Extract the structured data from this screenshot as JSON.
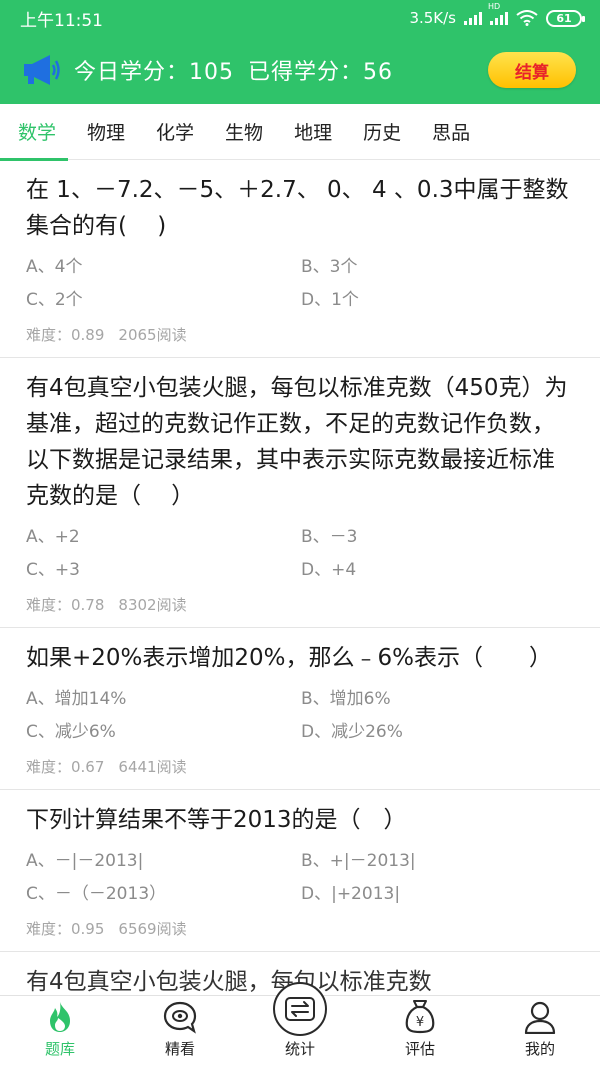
{
  "status": {
    "time": "上午11:51",
    "network_speed": "3.5K/s",
    "network_type": "HD",
    "battery": "61"
  },
  "header": {
    "today_credits_label": "今日学分：",
    "today_credits": "105",
    "earned_credits_label": "已得学分：",
    "earned_credits": "56",
    "settle_label": "结算"
  },
  "tabs": [
    {
      "label": "数学",
      "active": true
    },
    {
      "label": "物理"
    },
    {
      "label": "化学"
    },
    {
      "label": "生物"
    },
    {
      "label": "地理"
    },
    {
      "label": "历史"
    },
    {
      "label": "思品"
    }
  ],
  "questions": [
    {
      "title": "在 1、－7.2、－5、＋2.7、 0、 4 、0.3中属于整数集合的有(　 )",
      "options": [
        "A、4个",
        "B、3个",
        "C、2个",
        "D、1个"
      ],
      "difficulty_label": "难度：0.89",
      "reads": "2065阅读"
    },
    {
      "title": "有4包真空小包装火腿，每包以标准克数（450克）为基准，超过的克数记作正数，不足的克数记作负数，以下数据是记录结果，其中表示实际克数最接近标准克数的是（　 ）",
      "options": [
        "A、+2",
        "B、－3",
        "C、+3",
        "D、+4"
      ],
      "difficulty_label": "难度：0.78",
      "reads": "8302阅读"
    },
    {
      "title": "如果+20%表示增加20%，那么﹣6%表示（　　）",
      "options": [
        "A、增加14%",
        "B、增加6%",
        "C、减少6%",
        "D、减少26%"
      ],
      "difficulty_label": "难度：0.67",
      "reads": "6441阅读"
    },
    {
      "title": "下列计算结果不等于2013的是（　）",
      "options": [
        "A、－|－2013|",
        "B、+|－2013|",
        "C、－（－2013）",
        "D、|+2013|"
      ],
      "difficulty_label": "难度：0.95",
      "reads": "6569阅读"
    },
    {
      "title": "有4包真空小包装火腿，每包以标准克数"
    }
  ],
  "nav": [
    {
      "label": "题库",
      "icon": "flame-icon",
      "active": true
    },
    {
      "label": "精看",
      "icon": "eye-bubble-icon"
    },
    {
      "label": "统计",
      "icon": "exchange-icon"
    },
    {
      "label": "评估",
      "icon": "money-bag-icon"
    },
    {
      "label": "我的",
      "icon": "person-icon"
    }
  ],
  "colors": {
    "brand_green": "#2fc36a",
    "settle_yellow": "#ffc000",
    "settle_text": "#e8232a"
  }
}
